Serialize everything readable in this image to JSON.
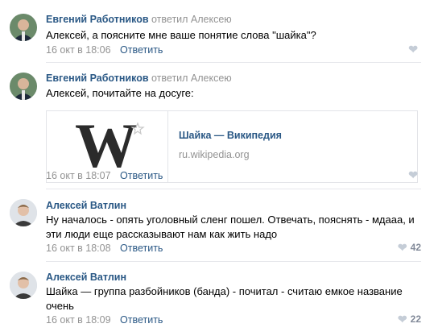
{
  "comments": [
    {
      "author": "Евгений Работников",
      "reply_to": "ответил Алексею",
      "text": "Алексей, а поясните мне ваше понятие слова \"шайка\"?",
      "date": "16 окт в 18:06",
      "reply_label": "Ответить",
      "likes": ""
    },
    {
      "author": "Евгений Работников",
      "reply_to": "ответил Алексею",
      "text": "Алексей, почитайте на досуге:",
      "date": "16 окт в 18:07",
      "reply_label": "Ответить",
      "likes": "",
      "link": {
        "title": "Шайка — Википедия",
        "domain": "ru.wikipedia.org"
      }
    },
    {
      "author": "Алексей Ватлин",
      "reply_to": "",
      "text": "Ну началось - опять уголовный сленг пошел. Отвечать, пояснять - мдааа, и эти люди еще рассказывают нам как жить надо",
      "date": "16 окт в 18:08",
      "reply_label": "Ответить",
      "likes": "42"
    },
    {
      "author": "Алексей Ватлин",
      "reply_to": "",
      "text": "Шайка — группа разбойников (банда) - почитал - считаю емкое название очень",
      "date": "16 окт в 18:09",
      "reply_label": "Ответить",
      "likes": "22"
    }
  ],
  "colors": {
    "link": "#2a5885",
    "muted": "#939393",
    "heart": "#c5cdd7"
  },
  "icons": {
    "like": "heart-icon",
    "wiki": "wikipedia-w-icon"
  }
}
